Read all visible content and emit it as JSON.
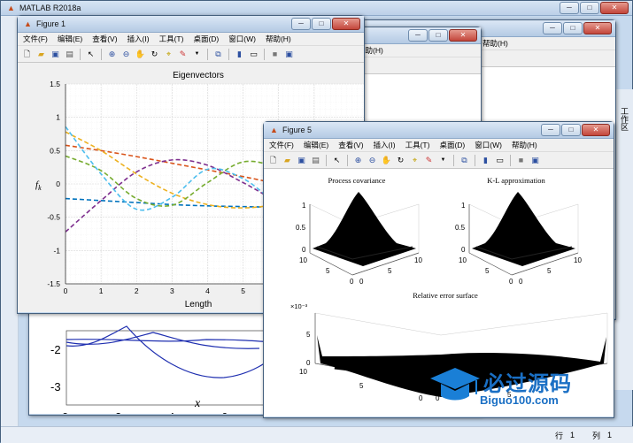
{
  "matlab": {
    "title": "MATLAB R2018a",
    "status_row_label": "行",
    "status_row": "1",
    "status_col_label": "列",
    "status_col": "1",
    "right_panel_label": "工作区"
  },
  "figures_back": {
    "menu_help": "帮助(H)"
  },
  "figure1": {
    "title": "Figure 1",
    "menu": [
      "文件(F)",
      "编辑(E)",
      "查看(V)",
      "插入(I)",
      "工具(T)",
      "桌面(D)",
      "窗口(W)",
      "帮助(H)"
    ],
    "toolbar_icons": [
      "new-file-icon",
      "open-folder-icon",
      "save-icon",
      "print-icon",
      "|",
      "pointer-icon",
      "|",
      "zoom-in-icon",
      "zoom-out-icon",
      "pan-hand-icon",
      "rotate-3d-icon",
      "data-cursor-icon",
      "brush-icon",
      "dropdown-arrow-icon",
      "|",
      "link-plot-icon",
      "|",
      "colorbar-icon",
      "legend-icon",
      "|",
      "hide-plot-tools-icon",
      "show-plot-tools-icon"
    ]
  },
  "figure5": {
    "title": "Figure 5",
    "menu": [
      "文件(F)",
      "编辑(E)",
      "查看(V)",
      "插入(I)",
      "工具(T)",
      "桌面(D)",
      "窗口(W)",
      "帮助(H)"
    ],
    "plots": {
      "process_title": "Process covariance",
      "kl_title": "K-L approximation",
      "error_title": "Relative error surface",
      "exponent": "×10⁻³",
      "z_ticks": [
        "1",
        "0.5",
        "0"
      ],
      "x_ticks": [
        "10",
        "5",
        "0"
      ],
      "y_ticks": [
        "0",
        "5",
        "10"
      ],
      "err_z_ticks": [
        "5",
        "0"
      ],
      "err_x_ticks": [
        "10",
        "5",
        "0"
      ],
      "err_y_ticks": [
        "0",
        "5"
      ]
    }
  },
  "background_plot": {
    "y_ticks": [
      "-2",
      "-3"
    ],
    "x_ticks": [
      "0",
      "2",
      "4",
      "6"
    ],
    "xlabel": "x"
  },
  "watermark": {
    "cn": "必过源码",
    "url": "Biguo100.com"
  },
  "chart_data": {
    "type": "line",
    "title": "Eigenvectors",
    "xlabel": "Length",
    "ylabel": "f_k",
    "xlim": [
      0,
      10
    ],
    "ylim": [
      -1.5,
      1.5
    ],
    "x_ticks": [
      0,
      1,
      2,
      3,
      4,
      5,
      6,
      7
    ],
    "y_ticks": [
      1.5,
      1,
      0.5,
      0,
      -0.5,
      -1,
      -1.5
    ],
    "grid": true,
    "line_style": "dashed",
    "series": [
      {
        "color": "#0072BD",
        "x": [
          0,
          1,
          2,
          3,
          4,
          5,
          6,
          7,
          8
        ],
        "values": [
          -0.22,
          -0.25,
          -0.28,
          -0.31,
          -0.33,
          -0.34,
          -0.35,
          -0.34,
          -0.33
        ]
      },
      {
        "color": "#D95319",
        "x": [
          0,
          1,
          2,
          3,
          4,
          5,
          6,
          7,
          8
        ],
        "values": [
          0.58,
          0.5,
          0.41,
          0.31,
          0.21,
          0.11,
          0.0,
          -0.11,
          -0.22
        ]
      },
      {
        "color": "#EDB120",
        "x": [
          0,
          1,
          2,
          3,
          4,
          5,
          6,
          7,
          8
        ],
        "values": [
          0.78,
          0.5,
          0.15,
          -0.14,
          -0.31,
          -0.36,
          -0.3,
          -0.17,
          -0.02
        ]
      },
      {
        "color": "#7E2F8E",
        "x": [
          0,
          1,
          2,
          3,
          4,
          5,
          6,
          7,
          8
        ],
        "values": [
          -0.72,
          -0.25,
          0.18,
          0.36,
          0.28,
          0.02,
          -0.26,
          -0.38,
          -0.28
        ]
      },
      {
        "color": "#77AC30",
        "x": [
          0,
          1,
          2,
          3,
          4,
          5,
          6,
          7,
          8
        ],
        "values": [
          0.42,
          0.2,
          -0.22,
          -0.32,
          0.02,
          0.33,
          0.22,
          -0.18,
          -0.28
        ]
      },
      {
        "color": "#4DBEEE",
        "x": [
          0,
          1,
          2,
          3,
          4,
          5,
          6,
          7,
          8
        ],
        "values": [
          0.86,
          0.15,
          -0.38,
          -0.2,
          0.22,
          0.08,
          -0.28,
          -0.3,
          -0.15
        ]
      }
    ]
  }
}
